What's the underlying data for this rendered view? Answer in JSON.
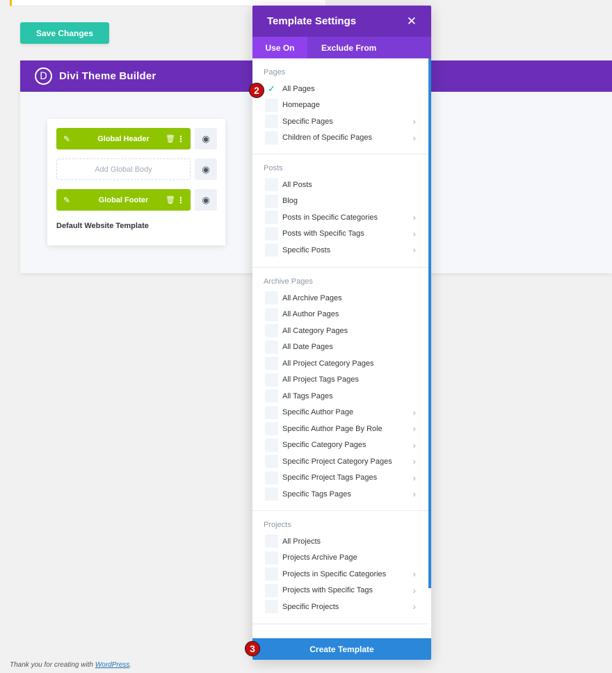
{
  "toolbar": {
    "save_label": "Save Changes"
  },
  "builder": {
    "logo_letter": "D",
    "title": "Divi Theme Builder",
    "template": {
      "header_label": "Global Header",
      "body_label": "Add Global Body",
      "footer_label": "Global Footer",
      "name": "Default Website Template"
    }
  },
  "modal": {
    "title": "Template Settings",
    "close_glyph": "✕",
    "tabs": [
      {
        "label": "Use On",
        "active": true
      },
      {
        "label": "Exclude From",
        "active": false
      }
    ],
    "sections": {
      "pages": {
        "title": "Pages",
        "items": [
          {
            "label": "All Pages",
            "checked": true,
            "has_sub": false
          },
          {
            "label": "Homepage",
            "checked": false,
            "has_sub": false
          },
          {
            "label": "Specific Pages",
            "checked": false,
            "has_sub": true
          },
          {
            "label": "Children of Specific Pages",
            "checked": false,
            "has_sub": true
          }
        ]
      },
      "posts": {
        "title": "Posts",
        "items": [
          {
            "label": "All Posts"
          },
          {
            "label": "Blog"
          },
          {
            "label": "Posts in Specific Categories"
          },
          {
            "label": "Posts with Specific Tags"
          },
          {
            "label": "Specific Posts"
          }
        ]
      },
      "archive": {
        "title": "Archive Pages",
        "items": [
          {
            "label": "All Archive Pages"
          },
          {
            "label": "All Author Pages"
          },
          {
            "label": "All Category Pages"
          },
          {
            "label": "All Date Pages"
          },
          {
            "label": "All Project Category Pages"
          },
          {
            "label": "All Project Tags Pages"
          },
          {
            "label": "All Tags Pages"
          },
          {
            "label": "Specific Author Page"
          },
          {
            "label": "Specific Author Page By Role"
          },
          {
            "label": "Specific Category Pages"
          },
          {
            "label": "Specific Project Category Pages"
          },
          {
            "label": "Specific Project Tags Pages"
          },
          {
            "label": "Specific Tags Pages"
          }
        ]
      },
      "projects": {
        "title": "Projects",
        "items": [
          {
            "label": "All Projects"
          },
          {
            "label": "Projects Archive Page"
          },
          {
            "label": "Projects in Specific Categories"
          },
          {
            "label": "Projects with Specific Tags"
          },
          {
            "label": "Specific Projects"
          }
        ]
      }
    },
    "create_label": "Create Template"
  },
  "badges": {
    "step2": "2",
    "step3": "3"
  },
  "footer": {
    "text": "Thank you for creating with",
    "link": "WordPress",
    "suffix": "."
  },
  "colors": {
    "purple": "#6c2eb9",
    "teal": "#29c4a9",
    "green": "#8fc400",
    "blue": "#2b87da",
    "badge_red": "#c90c0c"
  }
}
